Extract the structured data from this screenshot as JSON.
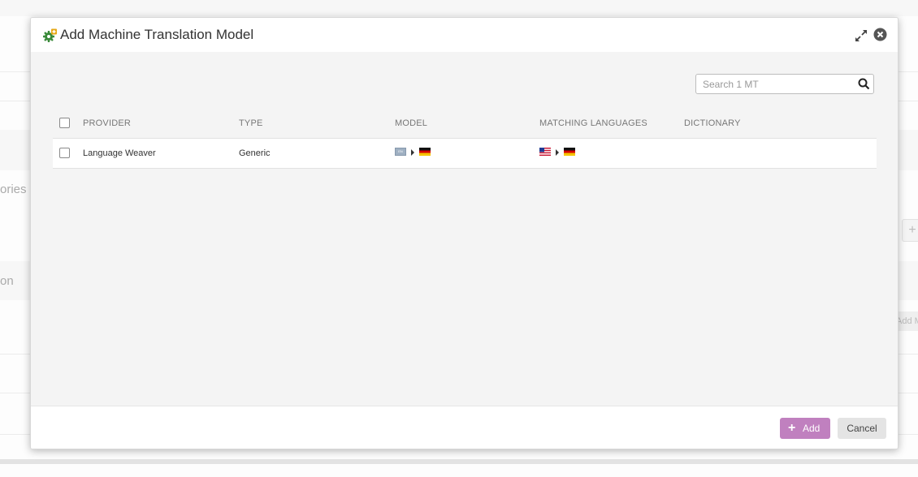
{
  "background": {
    "fragments": [
      "ories",
      "on"
    ],
    "add_button_fragment": "Add M",
    "plus_symbol": "+"
  },
  "modal": {
    "title": "Add Machine Translation Model",
    "icons": {
      "title": "gear-plus-icon",
      "expand": "expand-icon",
      "close": "close-circle-icon"
    },
    "search": {
      "placeholder": "Search 1 MT",
      "value": ""
    },
    "table": {
      "columns": [
        "PROVIDER",
        "TYPE",
        "MODEL",
        "MATCHING LANGUAGES",
        "DICTIONARY"
      ],
      "rows": [
        {
          "provider": "Language Weaver",
          "type": "Generic",
          "model": {
            "source_label": "EN",
            "source_flag": "generic-flag",
            "target_flag": "germany-flag"
          },
          "matching_languages": {
            "source_flag": "us-flag",
            "target_flag": "germany-flag"
          },
          "dictionary": ""
        }
      ]
    },
    "footer": {
      "add_label": "Add",
      "add_symbol": "+",
      "cancel_label": "Cancel"
    }
  },
  "colors": {
    "accent": "#c080bf",
    "modal_body": "#f4f4f4",
    "cancel_bg": "#e4e4e4"
  }
}
